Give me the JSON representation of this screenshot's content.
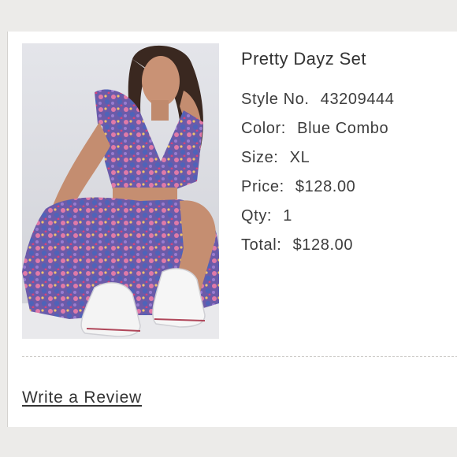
{
  "product": {
    "title": "Pretty Dayz Set",
    "image_alt": "Model wearing Pretty Dayz Set in blue floral print with white sneakers",
    "style": {
      "label": "Style No.",
      "value": "43209444"
    },
    "color": {
      "label": "Color:",
      "value": "Blue Combo"
    },
    "size": {
      "label": "Size:",
      "value": "XL"
    },
    "price": {
      "label": "Price:",
      "value": "$128.00"
    },
    "qty": {
      "label": "Qty:",
      "value": "1"
    },
    "total": {
      "label": "Total:",
      "value": "$128.00"
    }
  },
  "actions": {
    "review_label": "Write a Review"
  },
  "colors": {
    "text": "#333333",
    "page_background": "#ecebe9",
    "card_background": "#ffffff",
    "print_purple": "#6d5aa8",
    "print_pink": "#e07aa8",
    "print_blue": "#5566b8"
  }
}
